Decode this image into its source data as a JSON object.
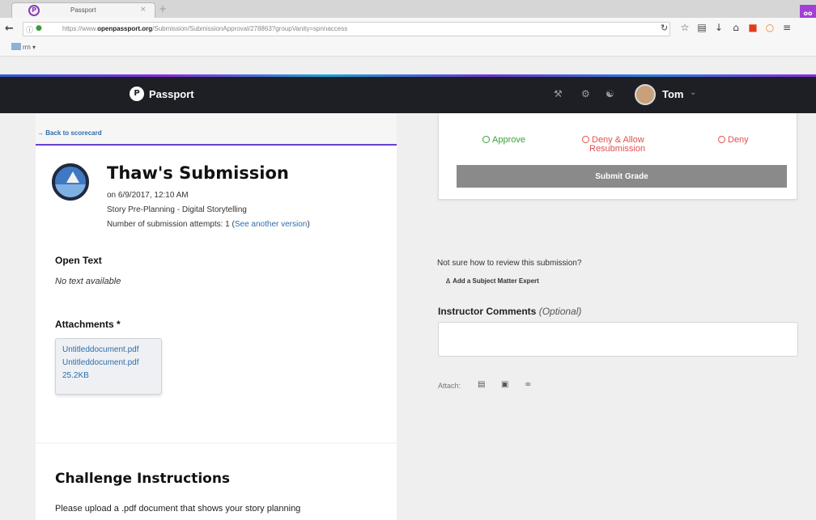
{
  "browser": {
    "tab_title": "Passport",
    "tab_close": "×",
    "new_tab": "+",
    "url_prefix": "https://www.",
    "url_domain": "openpassport.org",
    "url_path": "/Submission/SubmissionApproval/278863?groupVanity=spnnaccess",
    "bookmark_folder": "rrn",
    "ext_label": "oo"
  },
  "header": {
    "brand": "Passport",
    "user_name": "Tom"
  },
  "left": {
    "back_link": "→ Back to scorecard",
    "title": "Thaw's Submission",
    "date_line": "on 6/9/2017, 12:10 AM",
    "course_line": "Story Pre-Planning - Digital Storytelling",
    "attempts_text": "Number of submission attempts: 1 (",
    "attempts_link": "See another version",
    "attempts_close": ")",
    "open_text_heading": "Open Text",
    "open_text_value": "No text available",
    "attachments_heading": "Attachments *",
    "attachments": [
      "Untitleddocument.pdf",
      "Untitleddocument.pdf",
      "25.2KB"
    ],
    "challenge_heading": "Challenge Instructions",
    "challenge_text": "Please upload a .pdf document that shows your story planning"
  },
  "right": {
    "options": {
      "approve": "Approve",
      "deny_allow_1": "Deny & Allow",
      "deny_allow_2": "Resubmission",
      "deny": "Deny"
    },
    "submit_label": "Submit Grade",
    "review_question": "Not sure how to review this submission?",
    "add_expert": "Add a Subject Matter Expert",
    "comments_heading": "Instructor Comments",
    "comments_optional": "(Optional)",
    "comments_value": "",
    "attach_label": "Attach:"
  },
  "colors": {
    "header_bg": "#1d1f25",
    "accent_purple": "#6a3fd0",
    "approve_green": "#3aa034",
    "deny_red": "#e05050",
    "link_blue": "#2f6ea8",
    "submit_gray": "#8a8a8a"
  },
  "icons": {
    "header": [
      "tools-icon",
      "gear-icon",
      "community-icon"
    ],
    "attach": [
      "file-icon",
      "image-icon",
      "link-icon"
    ]
  }
}
